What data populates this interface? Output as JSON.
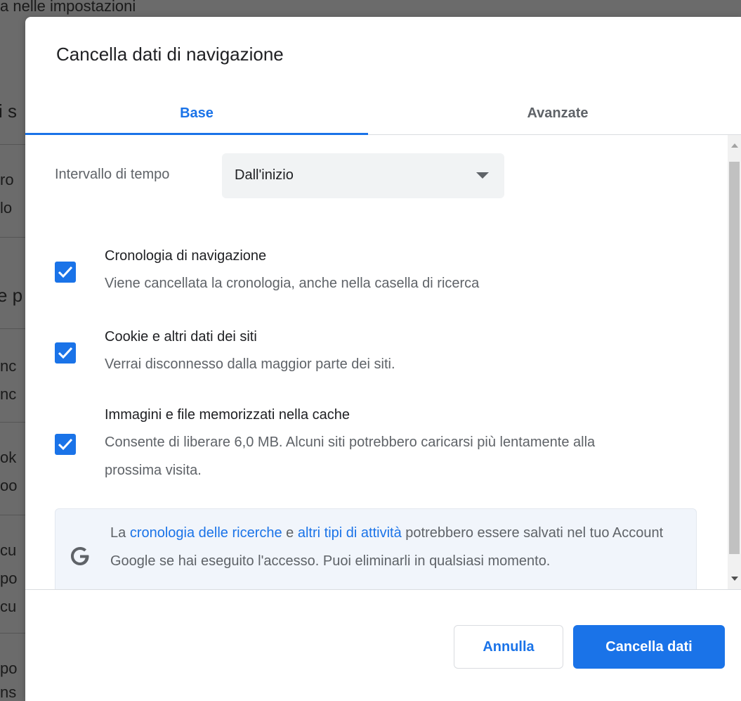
{
  "background": {
    "fragments": [
      "a nelle impostazioni",
      "i s",
      "ro",
      "lo",
      "e p",
      "nc",
      "nc",
      "ok",
      "oo",
      "cu",
      "po",
      "cu",
      "po",
      "ns"
    ]
  },
  "dialog": {
    "title": "Cancella dati di navigazione",
    "tabs": [
      {
        "label": "Base",
        "active": true
      },
      {
        "label": "Avanzate",
        "active": false
      }
    ],
    "time_range": {
      "label": "Intervallo di tempo",
      "value": "Dall'inizio"
    },
    "options": [
      {
        "title": "Cronologia di navigazione",
        "description": "Viene cancellata la cronologia, anche nella casella di ricerca",
        "checked": true
      },
      {
        "title": "Cookie e altri dati dei siti",
        "description": "Verrai disconnesso dalla maggior parte dei siti.",
        "checked": true
      },
      {
        "title": "Immagini e file memorizzati nella cache",
        "description": "Consente di liberare 6,0 MB. Alcuni siti potrebbero caricarsi più lentamente alla prossima visita.",
        "checked": true
      }
    ],
    "info": {
      "prefix": "La ",
      "link1": "cronologia delle ricerche",
      "middle": " e ",
      "link2": "altri tipi di attività",
      "suffix": " potrebbero essere salvati nel tuo Account Google se hai eseguito l'accesso. Puoi eliminarli in qualsiasi momento.",
      "icon": "google-g-icon"
    },
    "buttons": {
      "cancel": "Annulla",
      "confirm": "Cancella dati"
    }
  },
  "colors": {
    "accent": "#1a73e8",
    "secondary_text": "#5f6368",
    "primary_text": "#202124"
  }
}
